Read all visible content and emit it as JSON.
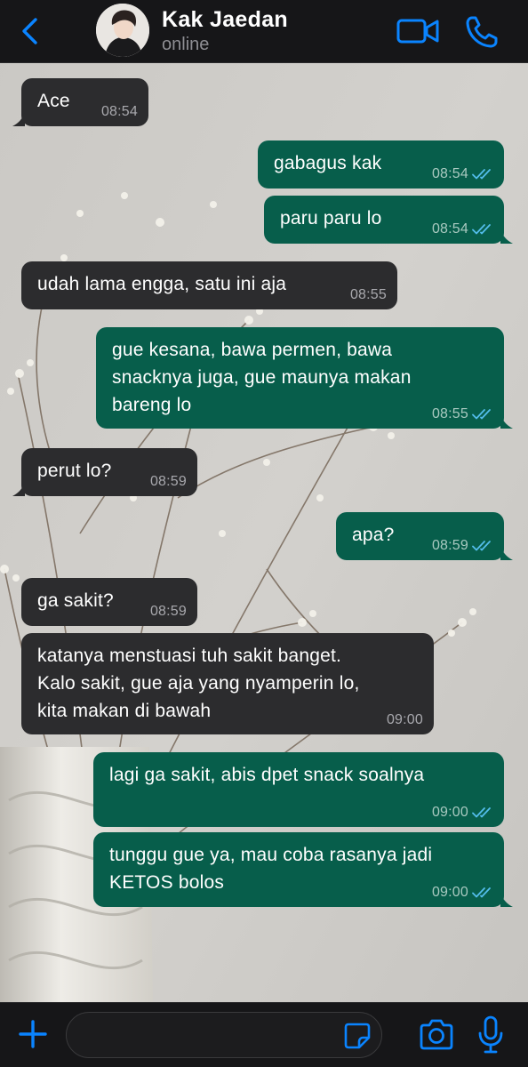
{
  "header": {
    "contact_name": "Kak Jaedan",
    "status": "online"
  },
  "colors": {
    "accent": "#0a84ff",
    "incoming_bubble": "#2c2c2e",
    "outgoing_bubble": "#075e4b",
    "read_ticks": "#53bdeb",
    "bar_background": "#161618"
  },
  "icons": {
    "back": "chevron-left-icon",
    "video": "video-camera-icon",
    "call": "phone-icon",
    "attach": "plus-icon",
    "sticker": "sticker-icon",
    "camera": "camera-icon",
    "mic": "microphone-icon",
    "read_status": "double-check-icon"
  },
  "messages": [
    {
      "direction": "in",
      "text": "Ace",
      "time": "08:54"
    },
    {
      "direction": "out",
      "text": "gabagus kak",
      "time": "08:54",
      "read": true
    },
    {
      "direction": "out",
      "text": "paru paru lo",
      "time": "08:54",
      "read": true
    },
    {
      "direction": "in",
      "text": "udah lama engga, satu ini aja",
      "time": "08:55"
    },
    {
      "direction": "out",
      "text": "gue kesana, bawa permen, bawa\nsnacknya juga, gue maunya makan\nbareng lo",
      "time": "08:55",
      "read": true
    },
    {
      "direction": "in",
      "text": "perut lo?",
      "time": "08:59"
    },
    {
      "direction": "out",
      "text": "apa?",
      "time": "08:59",
      "read": true
    },
    {
      "direction": "in",
      "text": "ga sakit?",
      "time": "08:59"
    },
    {
      "direction": "in",
      "text": "katanya menstuasi tuh sakit banget.\nKalo sakit, gue aja yang nyamperin lo,\nkita makan di bawah",
      "time": "09:00"
    },
    {
      "direction": "out",
      "text": "lagi ga sakit, abis dpet snack soalnya",
      "time": "09:00",
      "read": true
    },
    {
      "direction": "out",
      "text": "tunggu gue ya, mau coba rasanya jadi\nKETOS bolos",
      "time": "09:00",
      "read": true
    }
  ],
  "composer": {
    "value": "",
    "placeholder": ""
  }
}
